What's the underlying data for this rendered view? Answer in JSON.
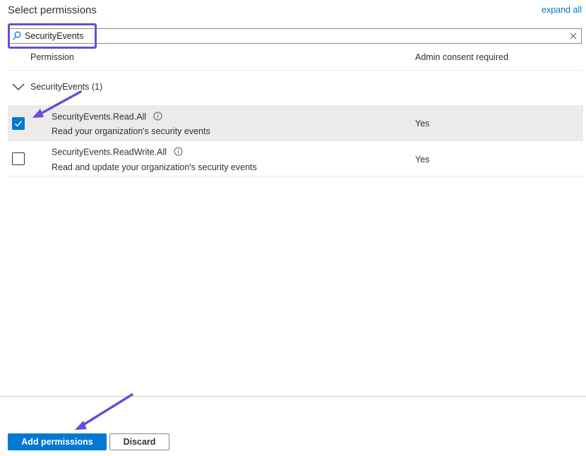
{
  "header": {
    "title": "Select permissions",
    "expand_all": "expand all"
  },
  "search": {
    "value": "SecurityEvents",
    "icon": "search-icon",
    "clear_icon": "close-icon"
  },
  "columns": {
    "permission": "Permission",
    "admin_consent": "Admin consent required"
  },
  "group": {
    "label": "SecurityEvents (1)",
    "expanded": true
  },
  "permissions": [
    {
      "name": "SecurityEvents.Read.All",
      "description": "Read your organization's security events",
      "admin_consent": "Yes",
      "checked": true
    },
    {
      "name": "SecurityEvents.ReadWrite.All",
      "description": "Read and update your organization's security events",
      "admin_consent": "Yes",
      "checked": false
    }
  ],
  "footer": {
    "add_label": "Add permissions",
    "discard_label": "Discard"
  },
  "colors": {
    "accent": "#0078d4",
    "annotation": "#6a4cd8",
    "selected_row": "#edebe9"
  }
}
